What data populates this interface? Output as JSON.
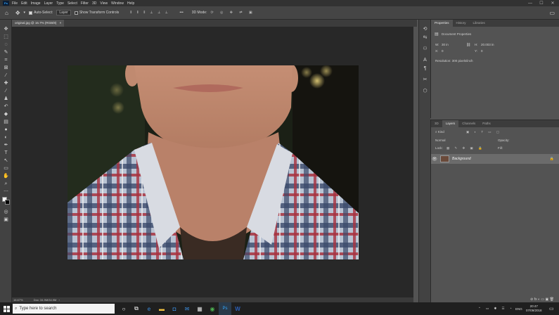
{
  "app": {
    "logo": "Ps"
  },
  "menu": [
    "File",
    "Edit",
    "Image",
    "Layer",
    "Type",
    "Select",
    "Filter",
    "3D",
    "View",
    "Window",
    "Help"
  ],
  "window_controls": {
    "minimize": "—",
    "maximize": "☐",
    "close": "✕"
  },
  "options": {
    "auto_select_label": "Auto-Select:",
    "auto_select_value": "Layer",
    "transform_label": "Show Transform Controls",
    "more": "•••",
    "mode_3d": "3D Mode:"
  },
  "document": {
    "tab_title": "original.jpg @ 16.7% (RGB/8)",
    "tab_close": "×",
    "zoom": "16.67%",
    "doc_info": "Doc: 34.9M/34.9M"
  },
  "properties": {
    "tabs": [
      "Properties",
      "History",
      "Libraries"
    ],
    "section": "Document Properties",
    "w_label": "W:",
    "w_value": "30 in",
    "h_label": "H:",
    "h_value": "20.003 in",
    "x_label": "X:",
    "x_value": "0",
    "y_label": "Y:",
    "y_value": "0",
    "resolution": "Resolution: 300 pixels/inch"
  },
  "layers": {
    "tabs": [
      "3D",
      "Layers",
      "Channels",
      "Paths"
    ],
    "filter_label": "Kind",
    "blend_mode": "Normal",
    "opacity_label": "Opacity:",
    "lock_label": "Lock:",
    "fill_label": "Fill:",
    "layer_name": "Background",
    "footer_icons": "⊘ fx ◐ ▭ ▣ 🗑"
  },
  "taskbar": {
    "search_placeholder": "Type here to search",
    "language": "ENG",
    "time": "20:47",
    "date": "07/09/2018"
  }
}
